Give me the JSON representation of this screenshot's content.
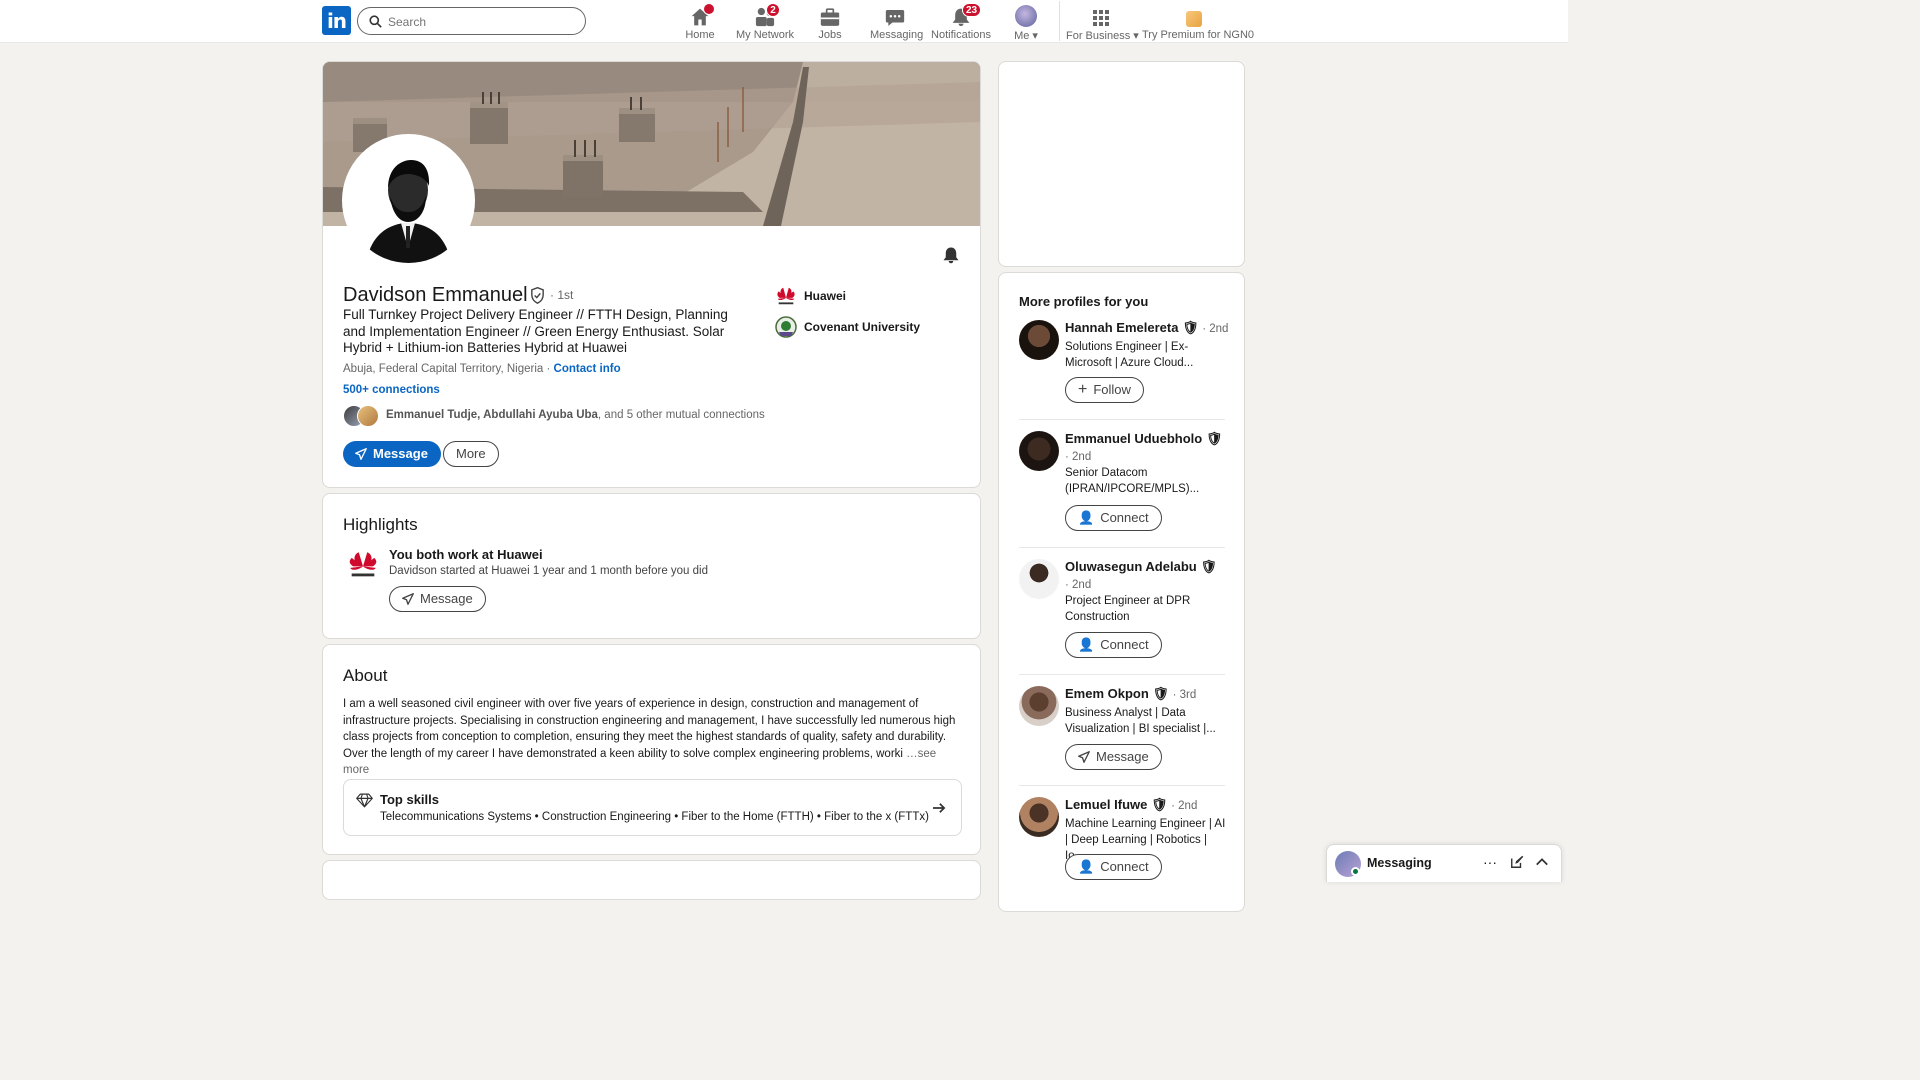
{
  "nav": {
    "logo": "in",
    "search_placeholder": "Search",
    "items": [
      {
        "label": "Home",
        "badge": ""
      },
      {
        "label": "My Network",
        "badge": "2"
      },
      {
        "label": "Jobs",
        "badge": ""
      },
      {
        "label": "Messaging",
        "badge": ""
      },
      {
        "label": "Notifications",
        "badge": "23"
      },
      {
        "label": "Me",
        "badge": ""
      },
      {
        "label": "For Business",
        "badge": ""
      },
      {
        "label": "Try Premium for NGN0",
        "badge": ""
      }
    ]
  },
  "profile": {
    "name": "Davidson Emmanuel",
    "degree": "· 1st",
    "headline": "Full Turnkey Project Delivery Engineer // FTTH Design, Planning and Implementation Engineer // Green Energy Enthusiast. Solar Hybrid + Lithium-ion Batteries Hybrid at Huawei",
    "location": "Abuja, Federal Capital Territory, Nigeria ·",
    "contact_info": "Contact info",
    "connections": "500+ connections",
    "mutual_names": "Emmanuel Tudje, Abdullahi Ayuba Uba",
    "mutual_rest": ", and 5 other mutual connections",
    "message_button": "Message",
    "more_button": "More",
    "orgs": [
      {
        "name": "Huawei"
      },
      {
        "name": "Covenant University"
      }
    ]
  },
  "highlights": {
    "title": "Highlights",
    "main": "You both work at Huawei",
    "sub": "Davidson started at Huawei 1 year and 1 month before you did",
    "button": "Message"
  },
  "about": {
    "title": "About",
    "text": "I am a well seasoned civil engineer with over five years of experience in design, construction and management of infrastructure projects. Specialising in construction engineering and management, I have successfully led numerous high class projects from conception to completion, ensuring they meet the highest standards of quality, safety and durability. Over the length of my career I have demonstrated a keen ability to solve complex engineering problems, worki",
    "see_more": "…see more",
    "top_skills_title": "Top skills",
    "top_skills": "Telecommunications Systems • Construction Engineering • Fiber to the Home (FTTH) • Fiber to the x (FTTx)"
  },
  "sidebar": {
    "title": "More profiles for you",
    "profiles": [
      {
        "name": "Hannah Emelereta",
        "degree": "· 2nd",
        "headline": "Solutions Engineer | Ex-Microsoft | Azure Cloud...",
        "action": "Follow"
      },
      {
        "name": "Emmanuel Uduebholo",
        "degree": "· 2nd",
        "headline": "Senior Datacom (IPRAN/IPCORE/MPLS)...",
        "action": "Connect"
      },
      {
        "name": "Oluwasegun Adelabu",
        "degree": "· 2nd",
        "headline": "Project Engineer at DPR Construction",
        "action": "Connect"
      },
      {
        "name": "Emem Okpon",
        "degree": "· 3rd",
        "headline": "Business Analyst | Data Visualization | BI specialist |...",
        "action": "Message"
      },
      {
        "name": "Lemuel Ifuwe",
        "degree": "· 2nd",
        "headline": "Machine Learning Engineer | AI | Deep Learning | Robotics | Io...",
        "action": "Connect"
      }
    ]
  },
  "messaging_dock": {
    "label": "Messaging"
  },
  "colors": {
    "brand": "#0a66c2",
    "badge": "#cb112d",
    "background": "#f4f2ee"
  }
}
